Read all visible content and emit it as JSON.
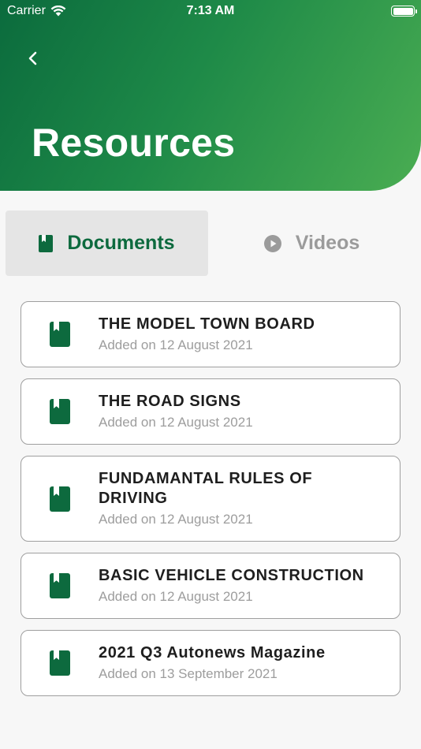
{
  "status_bar": {
    "carrier": "Carrier",
    "time": "7:13 AM"
  },
  "header": {
    "title": "Resources",
    "back_icon": "chevron-left-icon"
  },
  "colors": {
    "brand_green": "#0d6a3e",
    "brand_green_light": "#4aad52",
    "muted_text": "#9d9d9d"
  },
  "tabs": [
    {
      "label": "Documents",
      "icon": "book-icon",
      "active": true
    },
    {
      "label": "Videos",
      "icon": "play-circle-icon",
      "active": false
    }
  ],
  "documents": [
    {
      "title": "THE MODEL TOWN BOARD",
      "date": "Added on 12 August 2021"
    },
    {
      "title": "THE ROAD SIGNS",
      "date": "Added on 12 August 2021"
    },
    {
      "title": "FUNDAMANTAL RULES OF DRIVING",
      "date": "Added on 12 August 2021"
    },
    {
      "title": "BASIC VEHICLE CONSTRUCTION",
      "date": "Added on 12 August 2021"
    },
    {
      "title": "2021 Q3 Autonews Magazine",
      "date": "Added on 13 September 2021"
    }
  ]
}
